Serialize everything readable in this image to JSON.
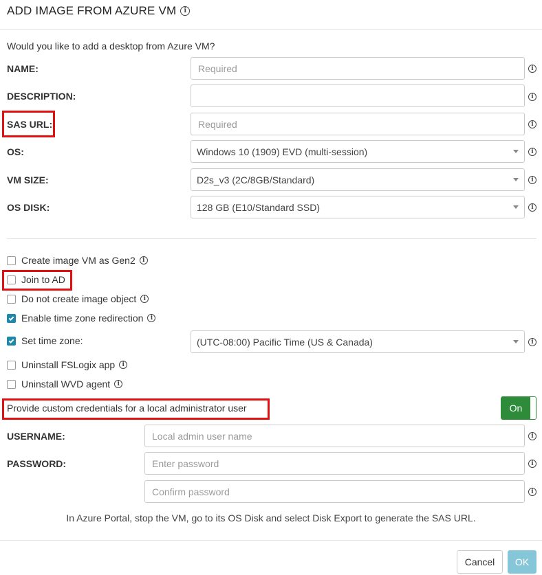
{
  "dialog": {
    "title": "ADD IMAGE FROM AZURE VM",
    "prompt": "Would you like to add a desktop from Azure VM?"
  },
  "fields": {
    "name": {
      "label": "NAME:",
      "placeholder": "Required",
      "value": ""
    },
    "description": {
      "label": "DESCRIPTION:",
      "placeholder": "",
      "value": ""
    },
    "sas_url": {
      "label": "SAS URL:",
      "placeholder": "Required",
      "value": ""
    },
    "os": {
      "label": "OS:",
      "selected": "Windows 10 (1909) EVD (multi-session)"
    },
    "vm_size": {
      "label": "VM SIZE:",
      "selected": "D2s_v3 (2C/8GB/Standard)"
    },
    "os_disk": {
      "label": "OS DISK:",
      "selected": "128 GB (E10/Standard SSD)"
    }
  },
  "options": {
    "gen2": {
      "label": "Create image VM as Gen2",
      "checked": false
    },
    "join_ad": {
      "label": "Join to AD",
      "checked": false
    },
    "no_image_object": {
      "label": "Do not create image object",
      "checked": false
    },
    "tz_redirect": {
      "label": "Enable time zone redirection",
      "checked": true
    },
    "set_tz": {
      "label": "Set time zone:",
      "checked": true,
      "selected": "(UTC-08:00) Pacific Time (US & Canada)"
    },
    "uninstall_fslogix": {
      "label": "Uninstall FSLogix app",
      "checked": false
    },
    "uninstall_wvd": {
      "label": "Uninstall WVD agent",
      "checked": false
    }
  },
  "credentials": {
    "toggle_label": "Provide custom credentials for a local administrator user",
    "toggle_state": "On",
    "username": {
      "label": "USERNAME:",
      "placeholder": "Local admin user name",
      "value": ""
    },
    "password": {
      "label": "PASSWORD:",
      "placeholder": "Enter password",
      "value": ""
    },
    "confirm": {
      "placeholder": "Confirm password",
      "value": ""
    }
  },
  "helper_text": "In Azure Portal, stop the VM, go to its OS Disk and select Disk Export to generate the SAS URL.",
  "buttons": {
    "cancel": "Cancel",
    "ok": "OK"
  },
  "icons": {
    "info": "info-icon",
    "dropdown": "chevron-down-icon",
    "check": "check-icon"
  },
  "colors": {
    "accent": "#1e88a8",
    "toggle_on": "#2e8b3a",
    "ok_button": "#85c6d8",
    "highlight": "#e01010"
  }
}
